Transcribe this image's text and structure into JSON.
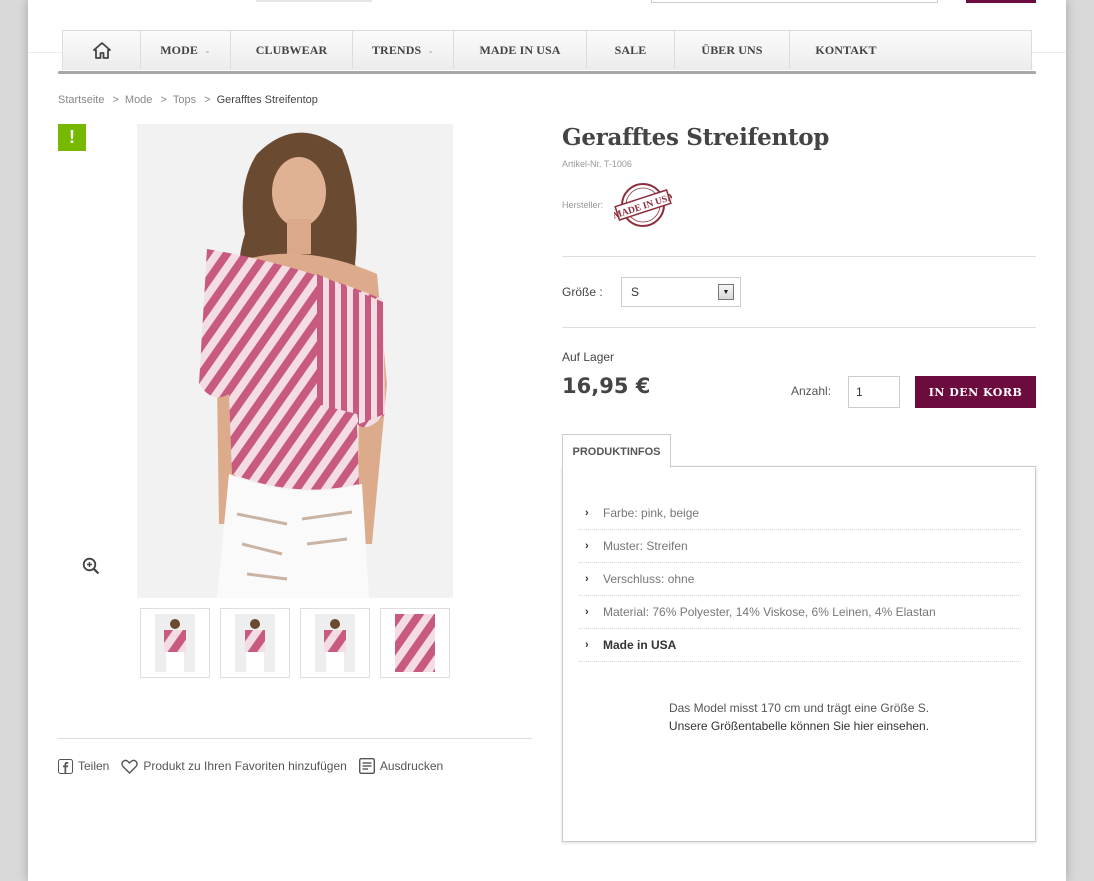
{
  "nav": {
    "items": [
      {
        "label": "",
        "icon": "home-icon"
      },
      {
        "label": "Mode",
        "dropdown": true
      },
      {
        "label": "Clubwear",
        "dropdown": false
      },
      {
        "label": "Trends",
        "dropdown": true
      },
      {
        "label": "Made in USA",
        "dropdown": false
      },
      {
        "label": "Sale",
        "dropdown": false
      },
      {
        "label": "Über uns",
        "dropdown": false
      },
      {
        "label": "Kontakt",
        "dropdown": false
      }
    ],
    "caret": "⌄"
  },
  "breadcrumb": {
    "items": [
      "Startseite",
      "Mode",
      "Tops"
    ],
    "separator": ">",
    "current": "Gerafftes Streifentop"
  },
  "badge": {
    "label": "!",
    "color": "#76b900"
  },
  "product": {
    "title": "Gerafftes Streifentop",
    "article_number": "Artikel-Nr. T-1006",
    "manufacturer_label": "Hersteller:",
    "manufacturer_stamp": "MADE IN USA",
    "size_label": "Größe :",
    "size_value": "S",
    "stock": "Auf Lager",
    "price": "16,95 €",
    "qty_label": "Anzahl:",
    "qty_value": "1",
    "cart_button": "IN DEN KORB",
    "accent_color": "#6b0b3e"
  },
  "tabs": {
    "active": "PRODUKTINFOS",
    "info_items": [
      {
        "text": "Farbe: pink, beige",
        "bold": false
      },
      {
        "text": "Muster: Streifen",
        "bold": false
      },
      {
        "text": "Verschluss: ohne",
        "bold": false
      },
      {
        "text": "Material: 76% Polyester, 14% Viskose, 6% Leinen, 4% Elastan",
        "bold": false
      },
      {
        "text": "Made in USA",
        "bold": true
      }
    ],
    "model_note_line1": "Das Model misst 170 cm und trägt eine Größe S.",
    "model_note_line2": "Unsere Größentabelle können Sie hier einsehen."
  },
  "actions": {
    "share": "Teilen",
    "favorite": "Produkt zu Ihren Favoriten hinzufügen",
    "print": "Ausdrucken"
  }
}
